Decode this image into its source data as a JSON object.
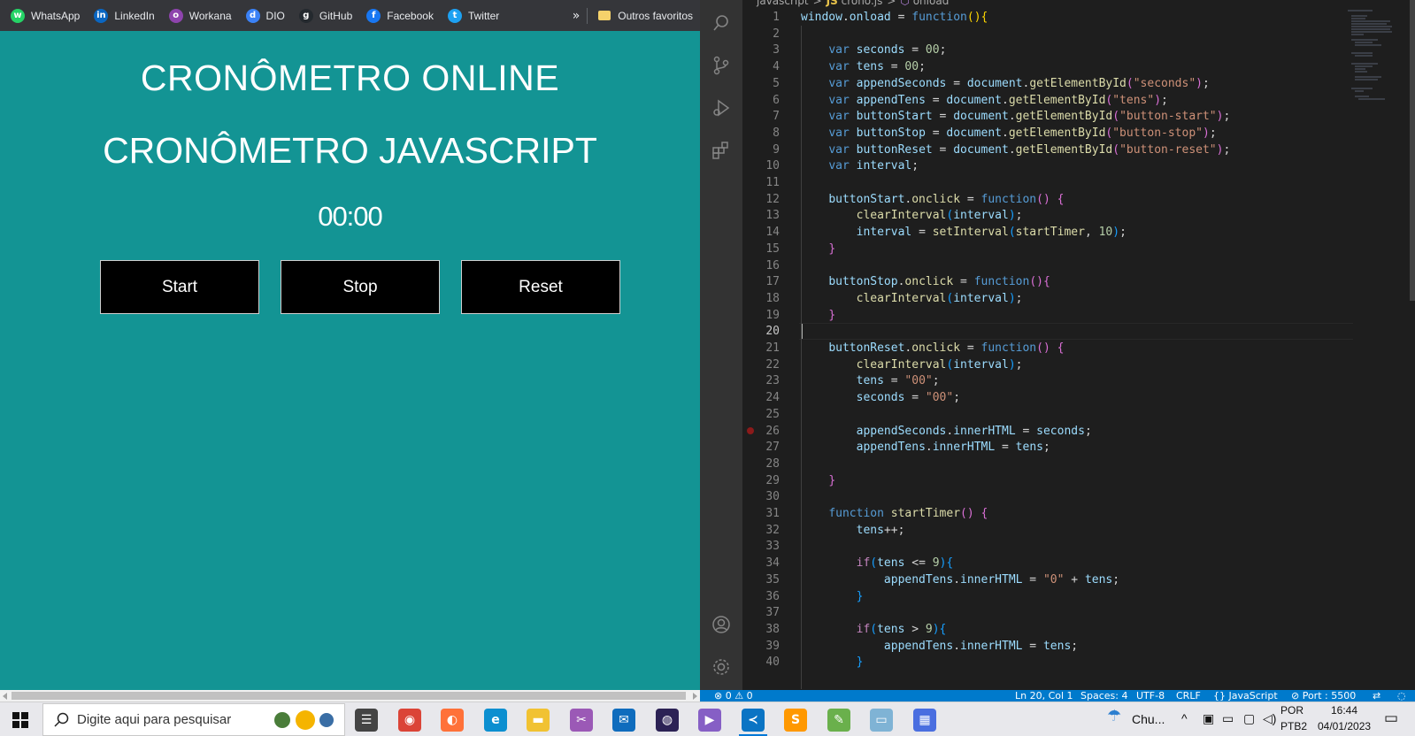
{
  "browser": {
    "bookmarks": [
      {
        "label": "WhatsApp",
        "icon": "whatsapp-icon",
        "color": "#25d366",
        "glyph": "w"
      },
      {
        "label": "LinkedIn",
        "icon": "linkedin-icon",
        "color": "#0a66c2",
        "glyph": "in"
      },
      {
        "label": "Workana",
        "icon": "workana-icon",
        "color": "#8e44ad",
        "glyph": "o"
      },
      {
        "label": "DIO",
        "icon": "dio-icon",
        "color": "#3b82f6",
        "glyph": "d"
      },
      {
        "label": "GitHub",
        "icon": "github-icon",
        "color": "#24292e",
        "glyph": "g"
      },
      {
        "label": "Facebook",
        "icon": "facebook-icon",
        "color": "#1877f2",
        "glyph": "f"
      },
      {
        "label": "Twitter",
        "icon": "twitter-icon",
        "color": "#1da1f2",
        "glyph": "t"
      }
    ],
    "more_label": "»",
    "folder_label": "Outros favoritos"
  },
  "page": {
    "title1": "CRONÔMETRO ONLINE",
    "title2": "CRONÔMETRO JAVASCRIPT",
    "timer": "00:00",
    "buttons": {
      "start": "Start",
      "stop": "Stop",
      "reset": "Reset"
    },
    "background": "#139494"
  },
  "editor": {
    "breadcrumb": [
      "javascript",
      "crono.js",
      "onload"
    ],
    "cursor_line": 20,
    "breakpoint_line": 26,
    "lines": [
      [
        [
          "window",
          "v"
        ],
        [
          ".",
          "p"
        ],
        [
          "onload",
          "v"
        ],
        [
          " = ",
          "p"
        ],
        [
          "function",
          "k"
        ],
        [
          "(){",
          "br1"
        ]
      ],
      [],
      [
        [
          "    ",
          "p"
        ],
        [
          "var",
          "k"
        ],
        [
          " seconds",
          "v"
        ],
        [
          " = ",
          "p"
        ],
        [
          "00",
          "n"
        ],
        [
          ";",
          "p"
        ]
      ],
      [
        [
          "    ",
          "p"
        ],
        [
          "var",
          "k"
        ],
        [
          " tens",
          "v"
        ],
        [
          " = ",
          "p"
        ],
        [
          "00",
          "n"
        ],
        [
          ";",
          "p"
        ]
      ],
      [
        [
          "    ",
          "p"
        ],
        [
          "var",
          "k"
        ],
        [
          " appendSeconds",
          "v"
        ],
        [
          " = ",
          "p"
        ],
        [
          "document",
          "v"
        ],
        [
          ".",
          "p"
        ],
        [
          "getElementById",
          "f"
        ],
        [
          "(",
          "br2"
        ],
        [
          "\"seconds\"",
          "s"
        ],
        [
          ")",
          "br2"
        ],
        [
          ";",
          "p"
        ]
      ],
      [
        [
          "    ",
          "p"
        ],
        [
          "var",
          "k"
        ],
        [
          " appendTens",
          "v"
        ],
        [
          " = ",
          "p"
        ],
        [
          "document",
          "v"
        ],
        [
          ".",
          "p"
        ],
        [
          "getElementById",
          "f"
        ],
        [
          "(",
          "br2"
        ],
        [
          "\"tens\"",
          "s"
        ],
        [
          ")",
          "br2"
        ],
        [
          ";",
          "p"
        ]
      ],
      [
        [
          "    ",
          "p"
        ],
        [
          "var",
          "k"
        ],
        [
          " buttonStart",
          "v"
        ],
        [
          " = ",
          "p"
        ],
        [
          "document",
          "v"
        ],
        [
          ".",
          "p"
        ],
        [
          "getElementById",
          "f"
        ],
        [
          "(",
          "br2"
        ],
        [
          "\"button-start\"",
          "s"
        ],
        [
          ")",
          "br2"
        ],
        [
          ";",
          "p"
        ]
      ],
      [
        [
          "    ",
          "p"
        ],
        [
          "var",
          "k"
        ],
        [
          " buttonStop",
          "v"
        ],
        [
          " = ",
          "p"
        ],
        [
          "document",
          "v"
        ],
        [
          ".",
          "p"
        ],
        [
          "getElementById",
          "f"
        ],
        [
          "(",
          "br2"
        ],
        [
          "\"button-stop\"",
          "s"
        ],
        [
          ")",
          "br2"
        ],
        [
          ";",
          "p"
        ]
      ],
      [
        [
          "    ",
          "p"
        ],
        [
          "var",
          "k"
        ],
        [
          " buttonReset",
          "v"
        ],
        [
          " = ",
          "p"
        ],
        [
          "document",
          "v"
        ],
        [
          ".",
          "p"
        ],
        [
          "getElementById",
          "f"
        ],
        [
          "(",
          "br2"
        ],
        [
          "\"button-reset\"",
          "s"
        ],
        [
          ")",
          "br2"
        ],
        [
          ";",
          "p"
        ]
      ],
      [
        [
          "    ",
          "p"
        ],
        [
          "var",
          "k"
        ],
        [
          " interval",
          "v"
        ],
        [
          ";",
          "p"
        ]
      ],
      [],
      [
        [
          "    ",
          "p"
        ],
        [
          "buttonStart",
          "v"
        ],
        [
          ".",
          "p"
        ],
        [
          "onclick",
          "f"
        ],
        [
          " = ",
          "p"
        ],
        [
          "function",
          "k"
        ],
        [
          "() {",
          "br2"
        ]
      ],
      [
        [
          "        ",
          "p"
        ],
        [
          "clearInterval",
          "f"
        ],
        [
          "(",
          "br3"
        ],
        [
          "interval",
          "v"
        ],
        [
          ")",
          "br3"
        ],
        [
          ";",
          "p"
        ]
      ],
      [
        [
          "        ",
          "p"
        ],
        [
          "interval",
          "v"
        ],
        [
          " = ",
          "p"
        ],
        [
          "setInterval",
          "f"
        ],
        [
          "(",
          "br3"
        ],
        [
          "startTimer",
          "f"
        ],
        [
          ", ",
          "p"
        ],
        [
          "10",
          "n"
        ],
        [
          ")",
          "br3"
        ],
        [
          ";",
          "p"
        ]
      ],
      [
        [
          "    ",
          "p"
        ],
        [
          "}",
          "br2"
        ]
      ],
      [],
      [
        [
          "    ",
          "p"
        ],
        [
          "buttonStop",
          "v"
        ],
        [
          ".",
          "p"
        ],
        [
          "onclick",
          "f"
        ],
        [
          " = ",
          "p"
        ],
        [
          "function",
          "k"
        ],
        [
          "(){",
          "br2"
        ]
      ],
      [
        [
          "        ",
          "p"
        ],
        [
          "clearInterval",
          "f"
        ],
        [
          "(",
          "br3"
        ],
        [
          "interval",
          "v"
        ],
        [
          ")",
          "br3"
        ],
        [
          ";",
          "p"
        ]
      ],
      [
        [
          "    ",
          "p"
        ],
        [
          "}",
          "br2"
        ]
      ],
      [],
      [
        [
          "    ",
          "p"
        ],
        [
          "buttonReset",
          "v"
        ],
        [
          ".",
          "p"
        ],
        [
          "onclick",
          "f"
        ],
        [
          " = ",
          "p"
        ],
        [
          "function",
          "k"
        ],
        [
          "() {",
          "br2"
        ]
      ],
      [
        [
          "        ",
          "p"
        ],
        [
          "clearInterval",
          "f"
        ],
        [
          "(",
          "br3"
        ],
        [
          "interval",
          "v"
        ],
        [
          ")",
          "br3"
        ],
        [
          ";",
          "p"
        ]
      ],
      [
        [
          "        ",
          "p"
        ],
        [
          "tens",
          "v"
        ],
        [
          " = ",
          "p"
        ],
        [
          "\"00\"",
          "s"
        ],
        [
          ";",
          "p"
        ]
      ],
      [
        [
          "        ",
          "p"
        ],
        [
          "seconds",
          "v"
        ],
        [
          " = ",
          "p"
        ],
        [
          "\"00\"",
          "s"
        ],
        [
          ";",
          "p"
        ]
      ],
      [],
      [
        [
          "        ",
          "p"
        ],
        [
          "appendSeconds",
          "v"
        ],
        [
          ".",
          "p"
        ],
        [
          "innerHTML",
          "v"
        ],
        [
          " = ",
          "p"
        ],
        [
          "seconds",
          "v"
        ],
        [
          ";",
          "p"
        ]
      ],
      [
        [
          "        ",
          "p"
        ],
        [
          "appendTens",
          "v"
        ],
        [
          ".",
          "p"
        ],
        [
          "innerHTML",
          "v"
        ],
        [
          " = ",
          "p"
        ],
        [
          "tens",
          "v"
        ],
        [
          ";",
          "p"
        ]
      ],
      [],
      [
        [
          "    ",
          "p"
        ],
        [
          "}",
          "br2"
        ]
      ],
      [],
      [
        [
          "    ",
          "p"
        ],
        [
          "function",
          "k"
        ],
        [
          " startTimer",
          "f"
        ],
        [
          "() {",
          "br2"
        ]
      ],
      [
        [
          "        ",
          "p"
        ],
        [
          "tens",
          "v"
        ],
        [
          "++;",
          "p"
        ]
      ],
      [],
      [
        [
          "        ",
          "p"
        ],
        [
          "if",
          "c"
        ],
        [
          "(",
          "br3"
        ],
        [
          "tens",
          "v"
        ],
        [
          " <= ",
          "p"
        ],
        [
          "9",
          "n"
        ],
        [
          "){",
          "br3"
        ]
      ],
      [
        [
          "            ",
          "p"
        ],
        [
          "appendTens",
          "v"
        ],
        [
          ".",
          "p"
        ],
        [
          "innerHTML",
          "v"
        ],
        [
          " = ",
          "p"
        ],
        [
          "\"0\"",
          "s"
        ],
        [
          " + ",
          "p"
        ],
        [
          "tens",
          "v"
        ],
        [
          ";",
          "p"
        ]
      ],
      [
        [
          "        ",
          "p"
        ],
        [
          "}",
          "br3"
        ]
      ],
      [],
      [
        [
          "        ",
          "p"
        ],
        [
          "if",
          "c"
        ],
        [
          "(",
          "br3"
        ],
        [
          "tens",
          "v"
        ],
        [
          " > ",
          "p"
        ],
        [
          "9",
          "n"
        ],
        [
          "){",
          "br3"
        ]
      ],
      [
        [
          "            ",
          "p"
        ],
        [
          "appendTens",
          "v"
        ],
        [
          ".",
          "p"
        ],
        [
          "innerHTML",
          "v"
        ],
        [
          " = ",
          "p"
        ],
        [
          "tens",
          "v"
        ],
        [
          ";",
          "p"
        ]
      ],
      [
        [
          "        ",
          "p"
        ],
        [
          "}",
          "br3"
        ]
      ]
    ]
  },
  "statusbar": {
    "problems": "⊗ 0 ⚠ 0",
    "position": "Ln 20, Col 1",
    "spaces": "Spaces: 4",
    "encoding": "UTF-8",
    "eol": "CRLF",
    "language": "{} JavaScript",
    "port": "⊘ Port : 5500"
  },
  "taskbar": {
    "search_placeholder": "Digite aqui para pesquisar",
    "apps": [
      {
        "name": "task-view-icon",
        "color": "#444444",
        "glyph": "☰"
      },
      {
        "name": "chrome-icon",
        "color": "#db4437",
        "glyph": "◉"
      },
      {
        "name": "firefox-icon",
        "color": "#ff7139",
        "glyph": "◐"
      },
      {
        "name": "edge-icon",
        "color": "#0c8fd0",
        "glyph": "e"
      },
      {
        "name": "file-explorer-icon",
        "color": "#f1c232",
        "glyph": "▬"
      },
      {
        "name": "snipping-tool-icon",
        "color": "#9b59b6",
        "glyph": "✂"
      },
      {
        "name": "mail-icon",
        "color": "#0f6cbd",
        "glyph": "✉"
      },
      {
        "name": "eclipse-icon",
        "color": "#2c2255",
        "glyph": "◍"
      },
      {
        "name": "visual-studio-icon",
        "color": "#865fc5",
        "glyph": "▶"
      },
      {
        "name": "vscode-icon",
        "color": "#0a74c4",
        "glyph": "≺",
        "active": true
      },
      {
        "name": "sublime-icon",
        "color": "#ff9800",
        "glyph": "S"
      },
      {
        "name": "notepad-plus-icon",
        "color": "#6ab04c",
        "glyph": "✎"
      },
      {
        "name": "notes-icon",
        "color": "#7fb3d5",
        "glyph": "▭"
      },
      {
        "name": "calculator-icon",
        "color": "#4a6ee0",
        "glyph": "▦"
      }
    ],
    "weather": "Chu...",
    "lang_top": "POR",
    "lang_bottom": "PTB2",
    "time": "16:44",
    "date": "04/01/2023"
  }
}
